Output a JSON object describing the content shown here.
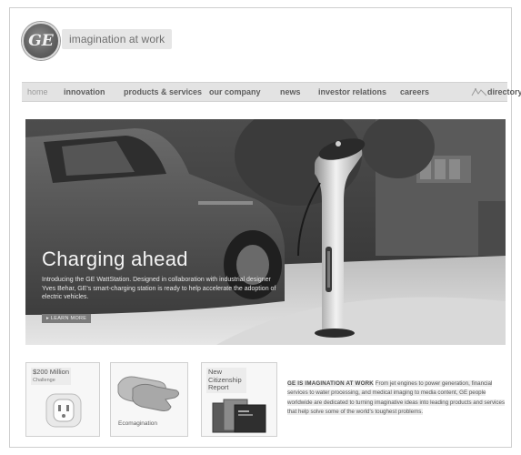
{
  "header": {
    "logo_text": "GE",
    "tagline": "imagination at work"
  },
  "nav": {
    "items": [
      {
        "label": "home"
      },
      {
        "label": "innovation"
      },
      {
        "label": "products & services"
      },
      {
        "label": "our company"
      },
      {
        "label": "news"
      },
      {
        "label": "investor relations"
      },
      {
        "label": "careers"
      },
      {
        "label": "directory"
      }
    ]
  },
  "hero": {
    "title": "Charging ahead",
    "description": "Introducing the GE WattStation. Designed in collaboration with industrial designer Yves Behar, GE's smart-charging station is ready to help accelerate the adoption of electric vehicles.",
    "cta": "LEARN MORE"
  },
  "promos": [
    {
      "title": "$200 Million",
      "subtitle": "Challenge",
      "caption": ""
    },
    {
      "title": "",
      "subtitle": "",
      "caption": "Ecomagination"
    },
    {
      "title": "New Citizenship Report",
      "subtitle": "",
      "caption": ""
    }
  ],
  "blurb": {
    "lead": "GE IS IMAGINATION AT WORK",
    "text": "From jet engines to power generation, financial services to water processing, and medical imaging to media content, GE people worldwide are dedicated to turning imaginative ideas into leading products and services that help solve some of the world's toughest problems."
  },
  "colors": {
    "nav_bg": "#e3e3e3",
    "hero_text": "#f4f4f4",
    "cta_bg": "#7a7a7a"
  }
}
